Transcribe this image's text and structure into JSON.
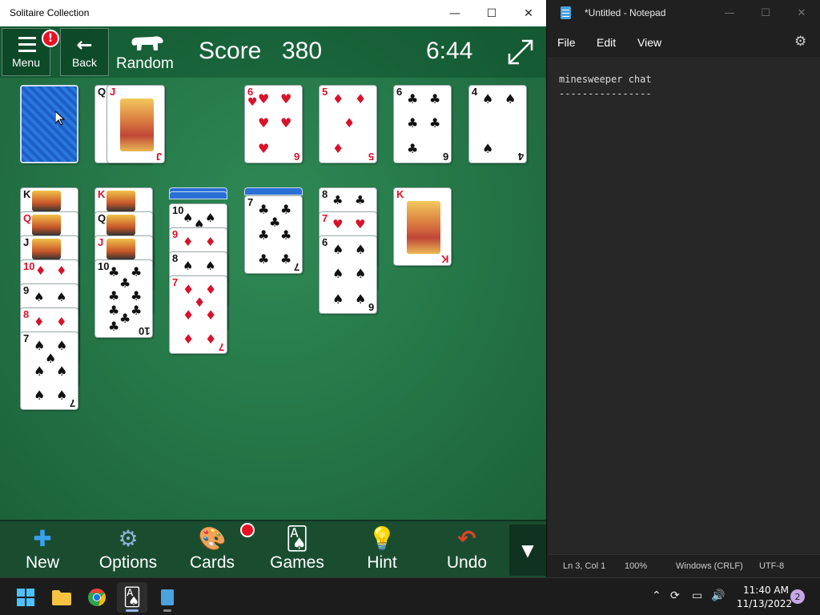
{
  "solitaire": {
    "title": "Solitaire Collection",
    "menu_label": "Menu",
    "menu_badge": "!",
    "back_label": "Back",
    "mode_label": "Random",
    "score_label": "Score",
    "score_value": "380",
    "timer": "6:44",
    "foundations": [
      {
        "rank": "6",
        "suit": "♥",
        "color": "red"
      },
      {
        "rank": "5",
        "suit": "♦",
        "color": "red"
      },
      {
        "rank": "6",
        "suit": "♣",
        "color": "black"
      },
      {
        "rank": "4",
        "suit": "♠",
        "color": "black"
      }
    ],
    "waste": [
      {
        "rank": "Q",
        "suit": "♠",
        "color": "black"
      },
      {
        "rank": "J",
        "suit": "♦",
        "color": "red"
      }
    ],
    "tableau": [
      [
        {
          "rank": "K",
          "suit": "♠",
          "color": "black"
        },
        {
          "rank": "Q",
          "suit": "♦",
          "color": "red"
        },
        {
          "rank": "J",
          "suit": "♣",
          "color": "black"
        },
        {
          "rank": "10",
          "suit": "♦",
          "color": "red"
        },
        {
          "rank": "9",
          "suit": "♠",
          "color": "black"
        },
        {
          "rank": "8",
          "suit": "♦",
          "color": "red"
        },
        {
          "rank": "7",
          "suit": "♠",
          "color": "black"
        }
      ],
      [
        {
          "rank": "K",
          "suit": "♥",
          "color": "red"
        },
        {
          "rank": "Q",
          "suit": "♣",
          "color": "black"
        },
        {
          "rank": "J",
          "suit": "♥",
          "color": "red"
        },
        {
          "rank": "10",
          "suit": "♣",
          "color": "black"
        }
      ],
      [
        {
          "rank": "10",
          "suit": "♠",
          "color": "black"
        },
        {
          "rank": "9",
          "suit": "♦",
          "color": "red"
        },
        {
          "rank": "8",
          "suit": "♠",
          "color": "black"
        },
        {
          "rank": "7",
          "suit": "♦",
          "color": "red"
        }
      ],
      [
        {
          "rank": "7",
          "suit": "♣",
          "color": "black"
        }
      ],
      [
        {
          "rank": "8",
          "suit": "♣",
          "color": "black"
        },
        {
          "rank": "7",
          "suit": "♥",
          "color": "red"
        },
        {
          "rank": "6",
          "suit": "♠",
          "color": "black"
        }
      ],
      [
        {
          "rank": "K",
          "suit": "♦",
          "color": "red"
        }
      ]
    ],
    "toolbar": {
      "new_label": "New",
      "options_label": "Options",
      "cards_label": "Cards",
      "games_label": "Games",
      "hint_label": "Hint",
      "undo_label": "Undo"
    },
    "colors": {
      "felt": "#2a7a4b",
      "toolbar": "#1a4d30",
      "red_suit": "#d8122a",
      "card_back": "#1d5fc4"
    }
  },
  "notepad": {
    "title": "*Untitled - Notepad",
    "menu": [
      "File",
      "Edit",
      "View"
    ],
    "content_line1": "minesweeper chat",
    "content_line2": "----------------",
    "status": {
      "position": "Ln 3, Col 1",
      "zoom": "100%",
      "line_ending": "Windows (CRLF)",
      "encoding": "UTF-8"
    }
  },
  "taskbar": {
    "clock_time": "11:40 AM",
    "clock_date": "11/13/2022",
    "notification_count": "2"
  }
}
